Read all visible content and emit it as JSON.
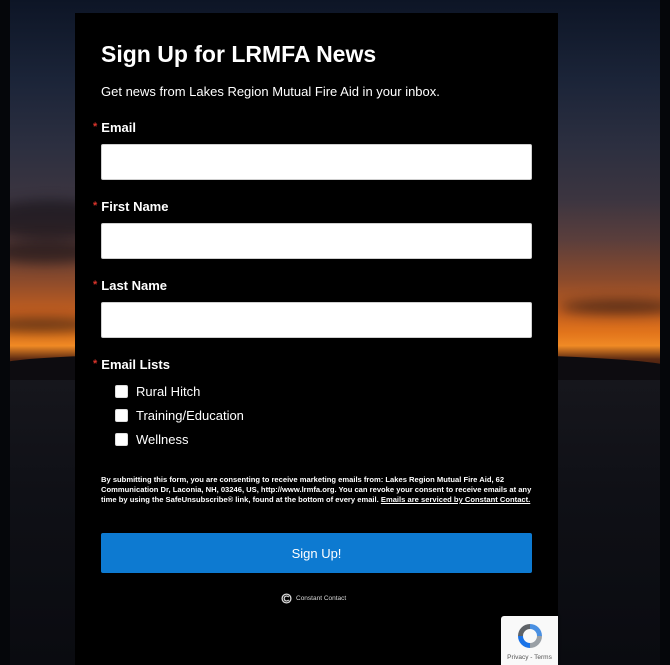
{
  "form": {
    "title": "Sign Up for LRMFA News",
    "subtitle": "Get news from Lakes Region Mutual Fire Aid in your inbox.",
    "required_marker": "*",
    "fields": {
      "email": {
        "label": "Email",
        "value": "",
        "placeholder": ""
      },
      "first_name": {
        "label": "First Name",
        "value": "",
        "placeholder": ""
      },
      "last_name": {
        "label": "Last Name",
        "value": "",
        "placeholder": ""
      }
    },
    "email_lists": {
      "label": "Email Lists",
      "options": [
        {
          "label": "Rural Hitch",
          "checked": false
        },
        {
          "label": "Training/Education",
          "checked": false
        },
        {
          "label": "Wellness",
          "checked": false
        }
      ]
    },
    "consent": {
      "text": "By submitting this form, you are consenting to receive marketing emails from: Lakes Region Mutual Fire Aid, 62 Communication Dr, Laconia, NH, 03246, US, http://www.lrmfa.org. You can revoke your consent to receive emails at any time by using the SafeUnsubscribe® link, found at the bottom of every email.",
      "link_text": "Emails are serviced by Constant Contact."
    },
    "submit_label": "Sign Up!",
    "powered_by": "Constant Contact"
  },
  "recaptcha": {
    "text": "Privacy - Terms"
  },
  "colors": {
    "panel_background": "#000000",
    "button": "#0d7ad1",
    "required": "#d9342b",
    "text": "#ffffff"
  },
  "icons": {
    "constant_contact_logo": "constant-contact-logo-icon",
    "recaptcha_logo": "recaptcha-icon"
  }
}
